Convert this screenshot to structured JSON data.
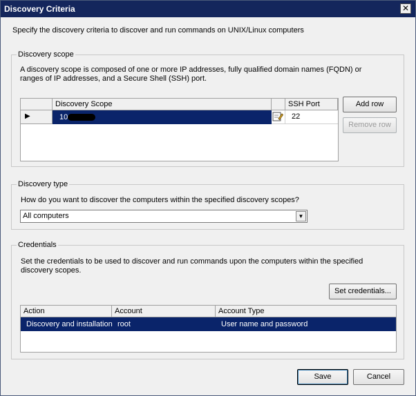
{
  "window": {
    "title": "Discovery Criteria",
    "close_glyph": "✕"
  },
  "intro": "Specify the discovery criteria to discover and run commands on UNIX/Linux computers",
  "discovery_scope": {
    "legend": "Discovery scope",
    "description_line1": "A discovery scope is composed of one or more IP addresses, fully qualified domain names (FQDN) or",
    "description_line2": "ranges of IP addresses, and a Secure Shell (SSH) port.",
    "columns": [
      "Discovery Scope",
      "SSH Port"
    ],
    "rows": [
      {
        "scope": "10.",
        "ssh_port": "22",
        "selected": true
      }
    ],
    "add_button": "Add row",
    "remove_button": "Remove row"
  },
  "discovery_type": {
    "legend": "Discovery type",
    "question": "How do you want to discover the computers within the specified discovery scopes?",
    "selected_option": "All computers"
  },
  "credentials": {
    "legend": "Credentials",
    "description_line1": "Set the credentials to be used to discover and run commands upon the computers within the specified",
    "description_line2": "discovery scopes.",
    "set_button": "Set credentials...",
    "columns": [
      "Action",
      "Account",
      "Account Type"
    ],
    "rows": [
      {
        "action": "Discovery and installation",
        "account": "root",
        "account_type": "User name and password"
      }
    ]
  },
  "footer": {
    "save_button": "Save",
    "cancel_button": "Cancel"
  },
  "colors": {
    "titlebar": "#14265c",
    "selection": "#0a246a",
    "background": "#f0f0f0"
  }
}
